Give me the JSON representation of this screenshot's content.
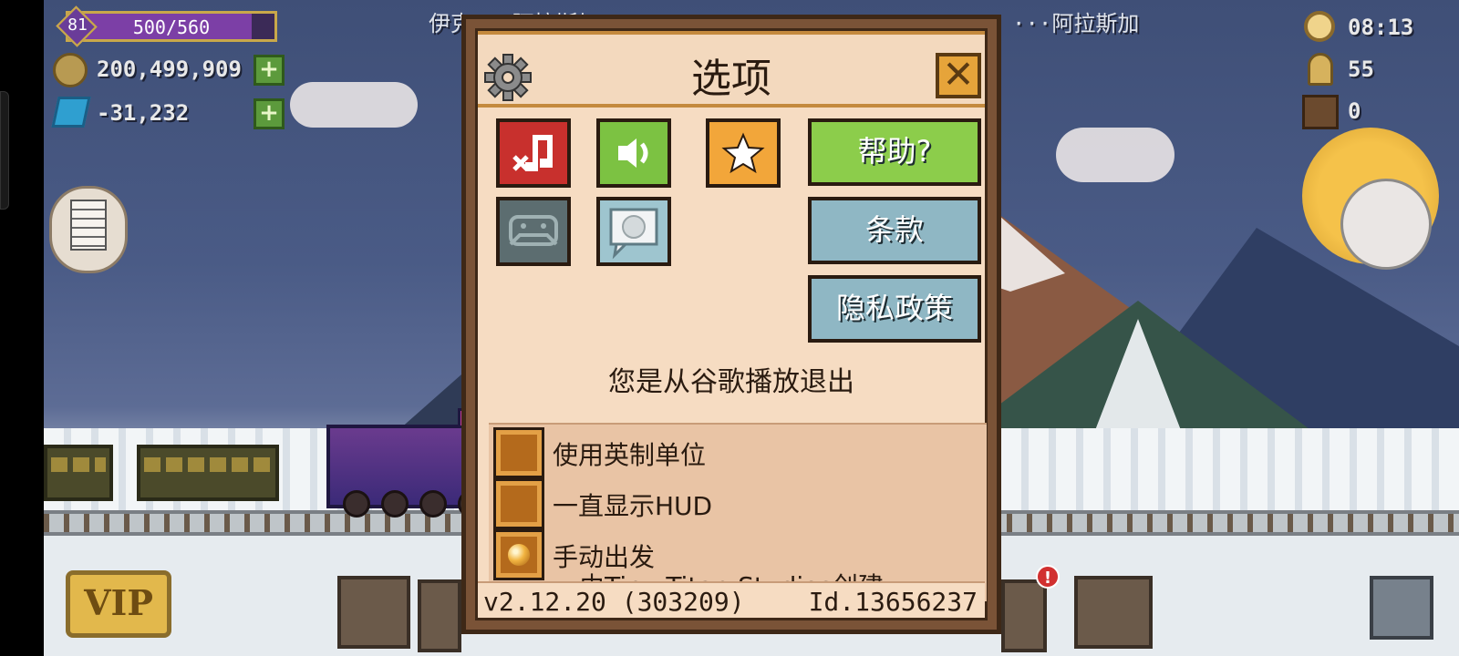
{
  "hud": {
    "level": "81",
    "xp": "500/560",
    "xp_fraction": 0.89,
    "coins": "200,499,909",
    "gems": "-31,232",
    "time": "08:13",
    "passengers": "55",
    "cargo": "0",
    "route_left": "伊克···阿拉斯加",
    "route_right": "···阿拉斯加",
    "vip_label": "VIP",
    "alert": "!"
  },
  "dialog": {
    "title": "选项",
    "close": "✕",
    "help": "帮助?",
    "terms": "条款",
    "privacy": "隐私政策",
    "status": "您是从谷歌播放退出",
    "options": [
      {
        "label": "使用英制单位",
        "checked": false
      },
      {
        "label": "一直显示HUD",
        "checked": false
      },
      {
        "label": "手动出发",
        "checked": true
      }
    ],
    "credit": "由Tiny Titan Studios创建",
    "version": "v2.12.20 (303209)",
    "user_id": "Id.13656237"
  },
  "colors": {
    "music_off": "#c8302d",
    "sound_on": "#7cc242",
    "favorite": "#f2a63a",
    "wide_green": "#8ccd4b",
    "wide_blue": "#8fb7c4"
  }
}
